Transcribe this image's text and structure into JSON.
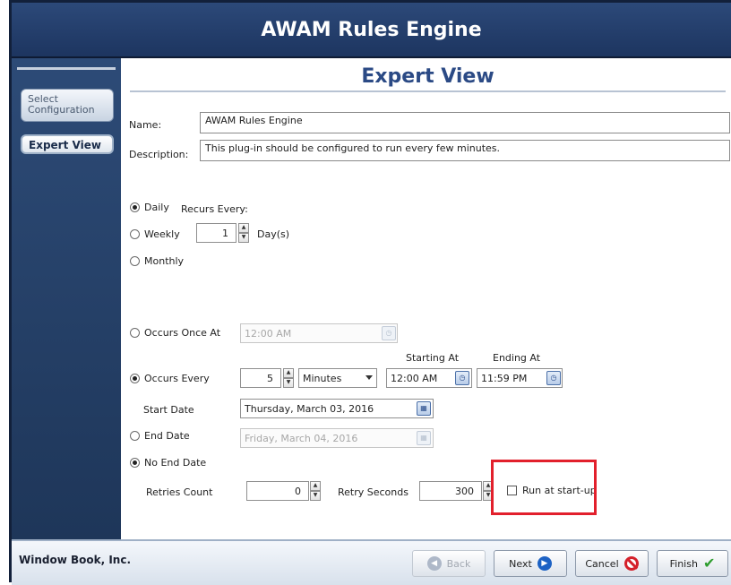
{
  "window": {
    "title": "AWAM Rules Engine"
  },
  "sidebar": {
    "items": [
      {
        "label": "Select Configuration"
      },
      {
        "label": "Expert View"
      }
    ]
  },
  "panel": {
    "title": "Expert View",
    "name_label": "Name:",
    "name_value": "AWAM Rules Engine",
    "description_label": "Description:",
    "description_value": "This plug-in should be configured to run every few minutes."
  },
  "recurrence": {
    "daily_label": "Daily",
    "weekly_label": "Weekly",
    "monthly_label": "Monthly",
    "selected": "Daily",
    "recurs_every_label": "Recurs Every:",
    "recurs_every_value": "1",
    "days_unit_label": "Day(s)"
  },
  "schedule": {
    "occurs_once_label": "Occurs Once At",
    "occurs_once_value": "12:00 AM",
    "occurs_every_label": "Occurs Every",
    "occurs_every_value": "5",
    "interval_unit": "Minutes",
    "starting_at_label": "Starting At",
    "starting_at_value": "12:00 AM",
    "ending_at_label": "Ending At",
    "ending_at_value": "11:59 PM",
    "selected": "Occurs Every",
    "start_date_label": "Start Date",
    "start_date_value": "Thursday, March 03, 2016",
    "end_date_label": "End Date",
    "end_date_value": "Friday, March 04, 2016",
    "no_end_date_label": "No End Date",
    "end_selected": "No End Date",
    "retries_count_label": "Retries Count",
    "retries_count_value": "0",
    "retry_seconds_label": "Retry Seconds",
    "retry_seconds_value": "300",
    "run_at_startup_label": "Run at start-up",
    "run_at_startup_checked": false
  },
  "footer": {
    "brand": "Window Book, Inc.",
    "back_label": "Back",
    "next_label": "Next",
    "cancel_label": "Cancel",
    "finish_label": "Finish"
  },
  "colors": {
    "title_bar": "#1d3560",
    "panel_title": "#2b4a85",
    "highlight": "#e2202c"
  },
  "icons": [
    "back-arrow-icon",
    "next-arrow-icon",
    "cancel-icon",
    "checkmark-icon",
    "calendar-icon",
    "clock-icon"
  ]
}
